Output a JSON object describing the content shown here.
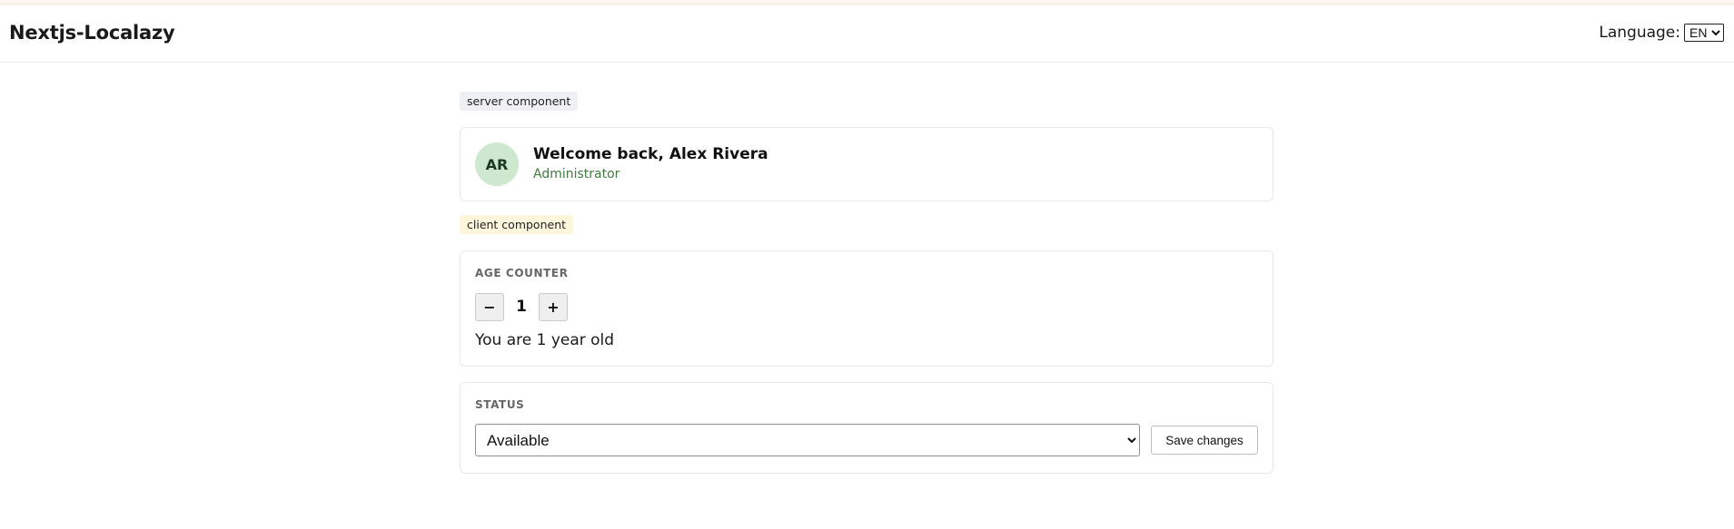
{
  "header": {
    "brand": "Nextjs-Localazy",
    "language_label": "Language:",
    "language_selected": "EN",
    "language_options": [
      "EN"
    ]
  },
  "server_section": {
    "tag": "server component",
    "avatar_initials": "AR",
    "welcome_title": "Welcome back, Alex Rivera",
    "role": "Administrator"
  },
  "client_section": {
    "tag": "client component",
    "counter": {
      "label": "AGE COUNTER",
      "decrement_label": "−",
      "increment_label": "+",
      "value": "1",
      "age_text": "You are 1 year old"
    },
    "status": {
      "label": "STATUS",
      "selected": "Available",
      "options": [
        "Available"
      ],
      "save_label": "Save changes"
    }
  },
  "colors": {
    "avatar_bg": "#cde8cf",
    "role_text": "#3f7b3f",
    "server_tag_bg": "#eef0f4",
    "client_tag_bg": "#fdf6dd"
  }
}
